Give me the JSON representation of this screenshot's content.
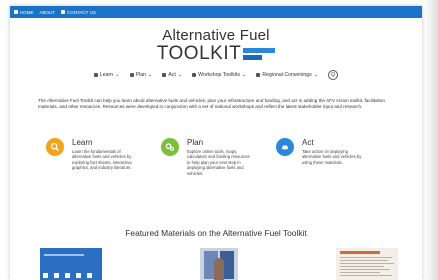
{
  "topbar": {
    "items": [
      {
        "label": "Home",
        "icon": "home-icon"
      },
      {
        "label": "About",
        "icon": ""
      },
      {
        "label": "Contact Us",
        "icon": "mail-icon"
      }
    ]
  },
  "logo": {
    "line1": "Alternative Fuel",
    "line2": "TOOLKIT"
  },
  "nav": {
    "items": [
      {
        "label": "Learn",
        "icon": "search-icon"
      },
      {
        "label": "Plan",
        "icon": "gears-icon"
      },
      {
        "label": "Act",
        "icon": "car-icon"
      },
      {
        "label": "Workshop Toolkits",
        "icon": "building-icon"
      },
      {
        "label": "Regional Convenings",
        "icon": "people-icon"
      }
    ],
    "search_symbol": "Q"
  },
  "intro": "The Alternative Fuel Toolkit can help you learn about alternative fuels and vehicles, plan your infrastructure and funding, and act in adding the AFV Action toolkit, facilitation materials, and other resources. Resources were developed in conjunction with a set of national workshops and reflect the latest stakeholder input and research.",
  "features": [
    {
      "title": "Learn",
      "desc": "Learn the fundamentals of alternative fuels and vehicles by exploring fact sheets, interactive graphics, and industry literature.",
      "color": "#f2a31b",
      "icon": "search-icon"
    },
    {
      "title": "Plan",
      "desc": "Explore online tools, maps, calculators and funding resources to help plan your next step in deploying alternative fuels and vehicles.",
      "color": "#7cbf3b",
      "icon": "gears-icon"
    },
    {
      "title": "Act",
      "desc": "Take action on deploying alternative fuels and vehicles by using these materials.",
      "color": "#2b88d8",
      "icon": "car-icon"
    }
  ],
  "featured_heading": "Featured Materials on the Alternative Fuel Toolkit",
  "colors": {
    "topbar": "#1a73c7",
    "accent": "#2b88d8"
  }
}
